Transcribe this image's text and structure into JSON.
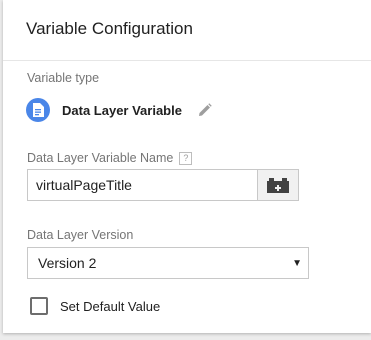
{
  "panel": {
    "title": "Variable Configuration"
  },
  "variable_type": {
    "section_label": "Variable type",
    "name": "Data Layer Variable",
    "icon": "document-icon",
    "accent_color": "#4a86e8"
  },
  "dlv_name": {
    "label": "Data Layer Variable Name",
    "help_icon": "?",
    "value": "virtualPageTitle",
    "picker_icon": "variable-picker-icon"
  },
  "dlv_version": {
    "label": "Data Layer Version",
    "selected": "Version 2"
  },
  "default_value": {
    "label": "Set Default Value",
    "checked": false
  }
}
